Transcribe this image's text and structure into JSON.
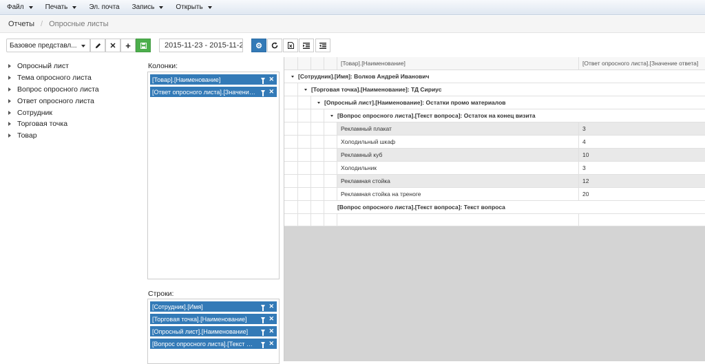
{
  "menu": [
    {
      "label": "Файл",
      "dropdown": true
    },
    {
      "label": "Печать",
      "dropdown": true
    },
    {
      "label": "Эл. почта",
      "dropdown": false
    },
    {
      "label": "Запись",
      "dropdown": true
    },
    {
      "label": "Открыть",
      "dropdown": true
    }
  ],
  "breadcrumb": {
    "root": "Отчеты",
    "current": "Опросные листы"
  },
  "toolbar": {
    "view_select": "Базовое представл...",
    "date_range": "2015-11-23 - 2015-11-2"
  },
  "fields": [
    "Опросный лист",
    "Тема опросного листа",
    "Вопрос опросного листа",
    "Ответ опросного листа",
    "Сотрудник",
    "Торговая точка",
    "Товар"
  ],
  "columns_panel": {
    "label": "Колонки:",
    "chips": [
      "[Товар].[Наименование]",
      "[Ответ опросного листа].[Значение о..."
    ]
  },
  "rows_panel": {
    "label": "Строки:",
    "chips": [
      "[Сотрудник].[Имя]",
      "[Торговая точка].[Наименование]",
      "[Опросный лист].[Наименование]",
      "[Вопрос опросного листа].[Текст воп..."
    ]
  },
  "grid": {
    "headers": [
      "[Товар].[Наименование]",
      "[Ответ опросного листа].[Значение ответа]"
    ],
    "groups": [
      "[Сотрудник].[Имя]: Волков Андрей Иванович",
      "[Торговая точка].[Наименование]: ТД Сириус",
      "[Опросный лист].[Наименование]: Остатки промо материалов",
      "[Вопрос опросного листа].[Текст вопроса]: Остаток на конец визита"
    ],
    "rows": [
      {
        "name": "Рекламный плакат",
        "value": "3"
      },
      {
        "name": "Холодильный шкаф",
        "value": "4"
      },
      {
        "name": "Рекламный куб",
        "value": "10"
      },
      {
        "name": "Холодильник",
        "value": "3"
      },
      {
        "name": "Рекламная стойка",
        "value": "12"
      },
      {
        "name": "Рекламная стойка на треноге",
        "value": "20"
      }
    ],
    "last_group": "[Вопрос опросного листа].[Текст вопроса]: Текст вопроса"
  }
}
